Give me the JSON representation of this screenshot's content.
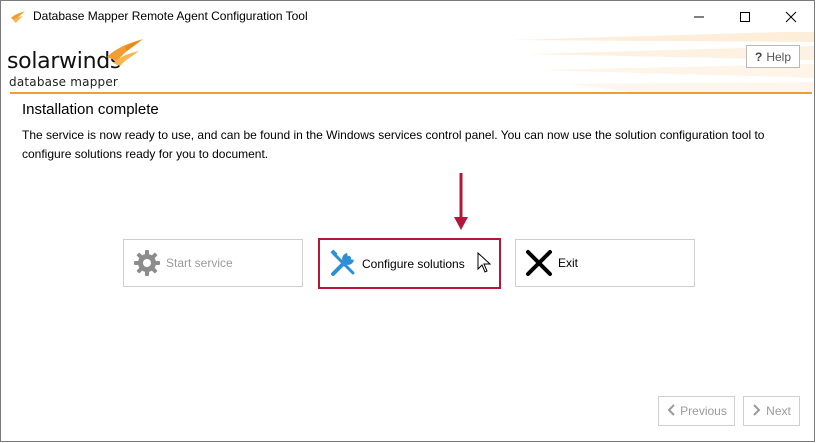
{
  "window": {
    "title": "Database Mapper Remote Agent Configuration Tool"
  },
  "header": {
    "logo_word": "solarwinds",
    "logo_sub": "database mapper",
    "help_label": "Help"
  },
  "main": {
    "heading": "Installation complete",
    "description": "The service is now ready to use, and can be found in the Windows services control panel. You can now use the solution configuration tool to configure solutions ready for you to document."
  },
  "actions": {
    "start_service": "Start service",
    "configure_solutions": "Configure solutions",
    "exit": "Exit"
  },
  "navigation": {
    "previous": "Previous",
    "next": "Next"
  },
  "icons": {
    "app": "solarwinds-flame-icon",
    "start": "gear-icon",
    "configure": "wrench-screwdriver-icon",
    "exit": "x-icon",
    "previous": "chevron-left-icon",
    "next": "chevron-right-icon",
    "highlight_arrow": "arrow-down-icon"
  },
  "colors": {
    "brand_orange": "#f29d31",
    "highlight": "#b3173a",
    "disabled_text": "#9a9a9a",
    "tool_blue": "#2d8fd5"
  }
}
